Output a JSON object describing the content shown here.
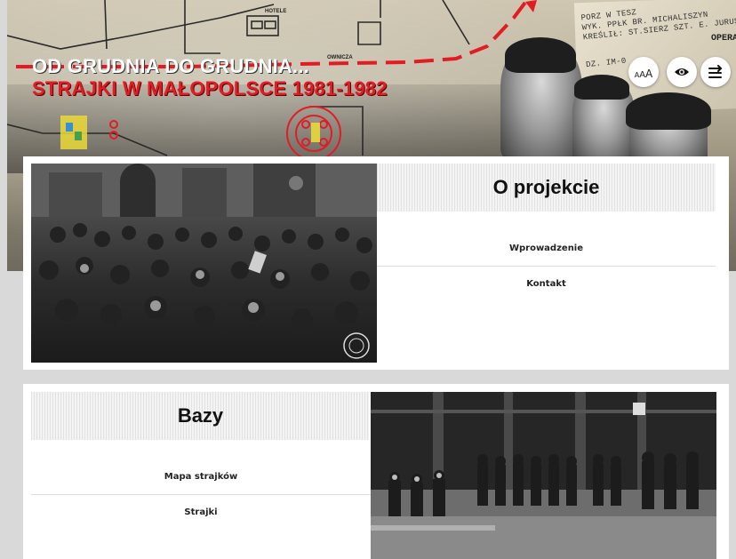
{
  "hero": {
    "title_line1": "OD GRUDNIA DO GRUDNIA...",
    "title_line2": "STRAJKI W MAŁOPOLSCE 1981-1982",
    "doc_lines": [
      "PORZ W TESZ",
      "WYK. PPŁK BR. MICHALISZYN",
      "KREŚLIŁ: ST.SIERZ SZT. E. JURUSIK",
      "DZ. IM-0"
    ],
    "map_labels": [
      "HOTELE",
      "OWNICZA",
      "OPERA"
    ],
    "colors": {
      "title_white": "#ffffff",
      "title_red": "#e31b23",
      "route_red": "#e31b23"
    }
  },
  "toolbar": {
    "font_size_label": "AAA",
    "contrast_icon": "eye-icon",
    "menu_icon": "menu-arrows-icon"
  },
  "cards": [
    {
      "heading": "O projekcie",
      "image": "photo-crowd-protest",
      "items": [
        {
          "label": "Wprowadzenie"
        },
        {
          "label": "Kontakt"
        }
      ]
    },
    {
      "heading": "Bazy",
      "image": "photo-riot-police-line",
      "items": [
        {
          "label": "Mapa strajków"
        },
        {
          "label": "Strajki"
        }
      ]
    }
  ]
}
